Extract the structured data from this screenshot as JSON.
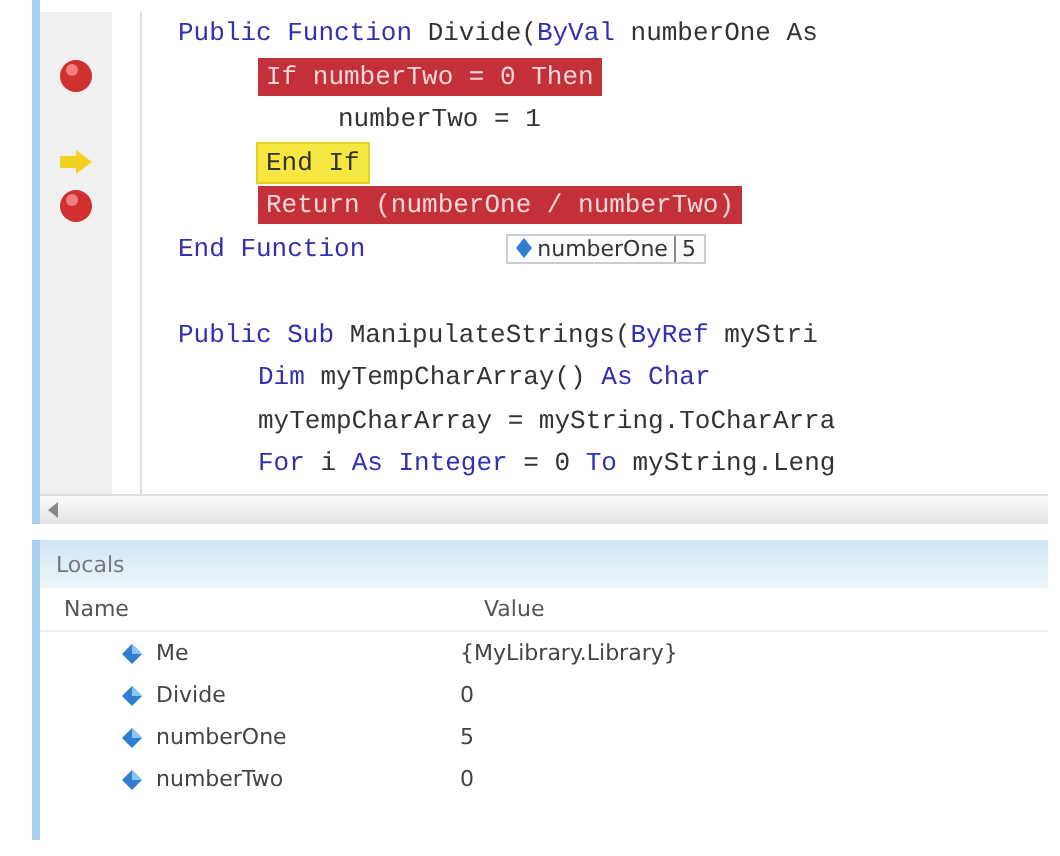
{
  "editor": {
    "lines": [
      {
        "kind": "code",
        "breakpoint": false,
        "current": false,
        "segments": [
          {
            "text": "Public Function",
            "kind": "keyword"
          },
          {
            "text": " Divide(",
            "kind": "plain"
          },
          {
            "text": "ByVal",
            "kind": "keyword"
          },
          {
            "text": " numberOne As",
            "kind": "plain"
          }
        ],
        "children": [
          {
            "kind": "code",
            "breakpoint": true,
            "current": false,
            "segments": [
              {
                "text": "If numberTwo = 0 Then",
                "kind": "plain"
              }
            ],
            "children": [
              {
                "kind": "code",
                "breakpoint": false,
                "current": false,
                "segments": [
                  {
                    "text": "numberTwo = 1",
                    "kind": "plain"
                  }
                ]
              }
            ]
          },
          {
            "kind": "code",
            "breakpoint": false,
            "current": true,
            "segments": [
              {
                "text": "End If",
                "kind": "plain"
              }
            ]
          },
          {
            "kind": "code",
            "breakpoint": true,
            "current": false,
            "segments": [
              {
                "text": "Return (numberOne / numberTwo)",
                "kind": "plain"
              }
            ]
          }
        ]
      },
      {
        "kind": "code",
        "breakpoint": false,
        "current": false,
        "segments": [
          {
            "text": "End Function",
            "kind": "keyword"
          }
        ],
        "datatip": {
          "name": "numberOne",
          "value": "5"
        }
      },
      {
        "kind": "blank"
      },
      {
        "kind": "code",
        "breakpoint": false,
        "current": false,
        "segments": [
          {
            "text": "Public Sub",
            "kind": "keyword"
          },
          {
            "text": " ManipulateStrings(",
            "kind": "plain"
          },
          {
            "text": "ByRef",
            "kind": "keyword"
          },
          {
            "text": " myStri",
            "kind": "plain"
          }
        ],
        "children": [
          {
            "kind": "code",
            "breakpoint": false,
            "current": false,
            "segments": [
              {
                "text": "Dim",
                "kind": "keyword"
              },
              {
                "text": " myTempCharArray() ",
                "kind": "plain"
              },
              {
                "text": "As Char",
                "kind": "keyword"
              }
            ]
          },
          {
            "kind": "code",
            "breakpoint": false,
            "current": false,
            "segments": [
              {
                "text": "myTempCharArray = myString.ToCharArra",
                "kind": "plain"
              }
            ]
          },
          {
            "kind": "code",
            "breakpoint": false,
            "current": false,
            "segments": [
              {
                "text": "For",
                "kind": "keyword"
              },
              {
                "text": " i ",
                "kind": "plain"
              },
              {
                "text": "As Integer",
                "kind": "keyword"
              },
              {
                "text": " = 0 ",
                "kind": "plain"
              },
              {
                "text": "To",
                "kind": "keyword"
              },
              {
                "text": " myString.Leng",
                "kind": "plain"
              }
            ]
          }
        ]
      }
    ]
  },
  "locals": {
    "title": "Locals",
    "columns": [
      "Name",
      "Value"
    ],
    "rows": [
      {
        "name": "Me",
        "value": "{MyLibrary.Library}"
      },
      {
        "name": "Divide",
        "value": "0"
      },
      {
        "name": "numberOne",
        "value": "5"
      },
      {
        "name": "numberTwo",
        "value": "0"
      }
    ]
  }
}
